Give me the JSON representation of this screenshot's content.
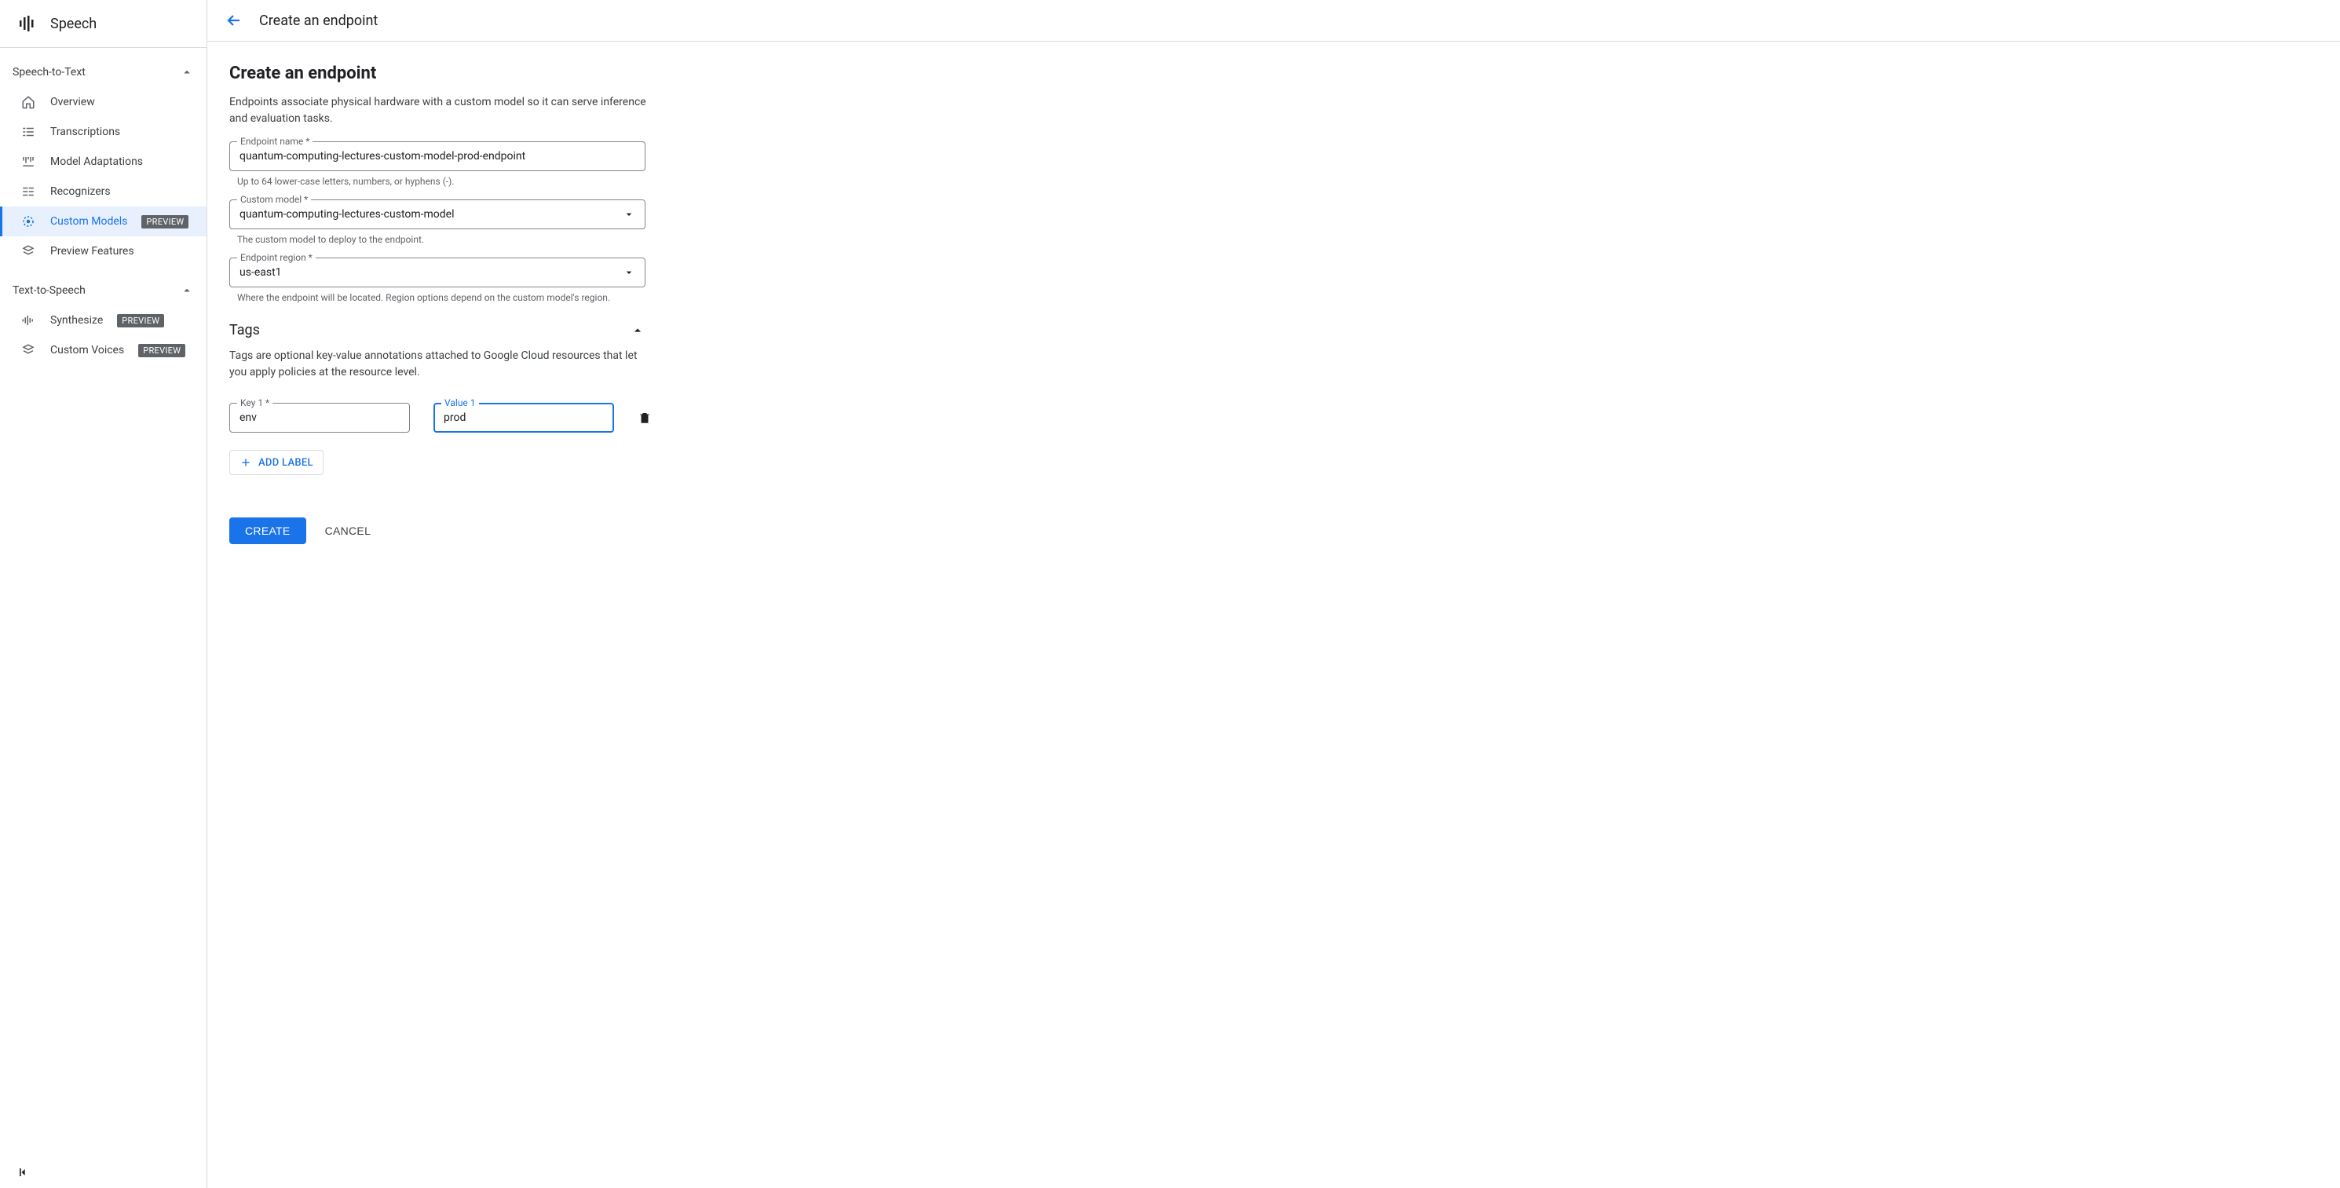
{
  "sidebar": {
    "product_title": "Speech",
    "sections": [
      {
        "label": "Speech-to-Text",
        "items": [
          {
            "label": "Overview",
            "icon": "home",
            "badge": null,
            "active": false
          },
          {
            "label": "Transcriptions",
            "icon": "list",
            "badge": null,
            "active": false
          },
          {
            "label": "Model Adaptations",
            "icon": "tune",
            "badge": null,
            "active": false
          },
          {
            "label": "Recognizers",
            "icon": "lines",
            "badge": null,
            "active": false
          },
          {
            "label": "Custom Models",
            "icon": "target",
            "badge": "PREVIEW",
            "active": true
          },
          {
            "label": "Preview Features",
            "icon": "stack",
            "badge": null,
            "active": false
          }
        ]
      },
      {
        "label": "Text-to-Speech",
        "items": [
          {
            "label": "Synthesize",
            "icon": "wave",
            "badge": "PREVIEW",
            "active": false
          },
          {
            "label": "Custom Voices",
            "icon": "stack",
            "badge": "PREVIEW",
            "active": false
          }
        ]
      }
    ]
  },
  "header": {
    "title": "Create an endpoint"
  },
  "form": {
    "heading": "Create an endpoint",
    "description": "Endpoints associate physical hardware with a custom model so it can serve inference and evaluation tasks.",
    "endpoint_name": {
      "label": "Endpoint name *",
      "value": "quantum-computing-lectures-custom-model-prod-endpoint",
      "helper": "Up to 64 lower-case letters, numbers, or hyphens (-)."
    },
    "custom_model": {
      "label": "Custom model *",
      "value": "quantum-computing-lectures-custom-model",
      "helper": "The custom model to deploy to the endpoint."
    },
    "endpoint_region": {
      "label": "Endpoint region *",
      "value": "us-east1",
      "helper": "Where the endpoint will be located. Region options depend on the custom model's region."
    },
    "tags": {
      "title": "Tags",
      "description": "Tags are optional key-value annotations attached to Google Cloud resources that let you apply policies at the resource level.",
      "rows": [
        {
          "key_label": "Key 1 *",
          "key_value": "env",
          "value_label": "Value 1",
          "value_value": "prod"
        }
      ],
      "add_label": "ADD LABEL"
    },
    "actions": {
      "create": "CREATE",
      "cancel": "CANCEL"
    }
  }
}
